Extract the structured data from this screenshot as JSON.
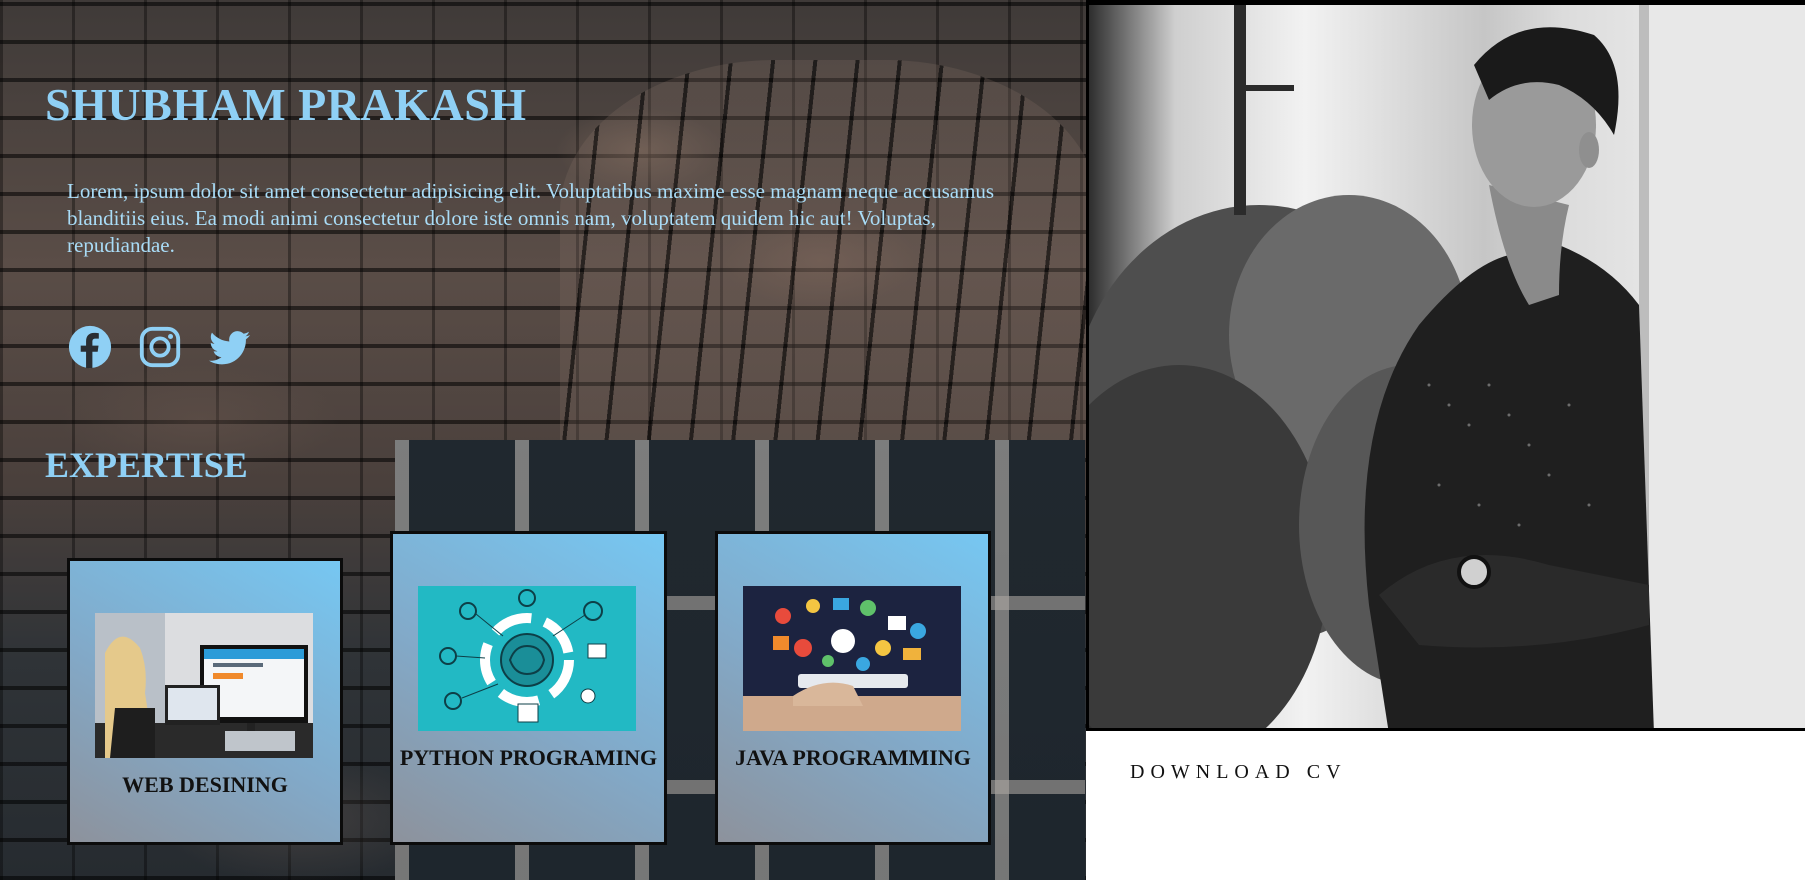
{
  "profile": {
    "name": "SHUBHAM PRAKASH",
    "bio": "Lorem, ipsum dolor sit amet consectetur adipisicing elit. Voluptatibus maxime esse magnam neque accusamus blanditiis eius. Ea modi animi consectetur dolore iste omnis nam, voluptatem quidem hic aut! Voluptas, repudiandae."
  },
  "socials": [
    {
      "icon": "facebook-icon"
    },
    {
      "icon": "instagram-icon"
    },
    {
      "icon": "twitter-icon"
    }
  ],
  "expertise": {
    "title": "EXPERTISE",
    "cards": [
      {
        "label": "WEB DESINING",
        "image": "web-design-image"
      },
      {
        "label": "PYTHON PROGRAMING",
        "image": "python-brain-image"
      },
      {
        "label": "JAVA PROGRAMMING",
        "image": "java-tablet-image"
      }
    ]
  },
  "download": {
    "label": "DOWNLOAD CV"
  },
  "colors": {
    "heading": "#8fd0f5",
    "bio_text": "#a9dcf7",
    "card_gradient_top": "#76c7f2",
    "card_gradient_bottom": "#8d929c"
  }
}
